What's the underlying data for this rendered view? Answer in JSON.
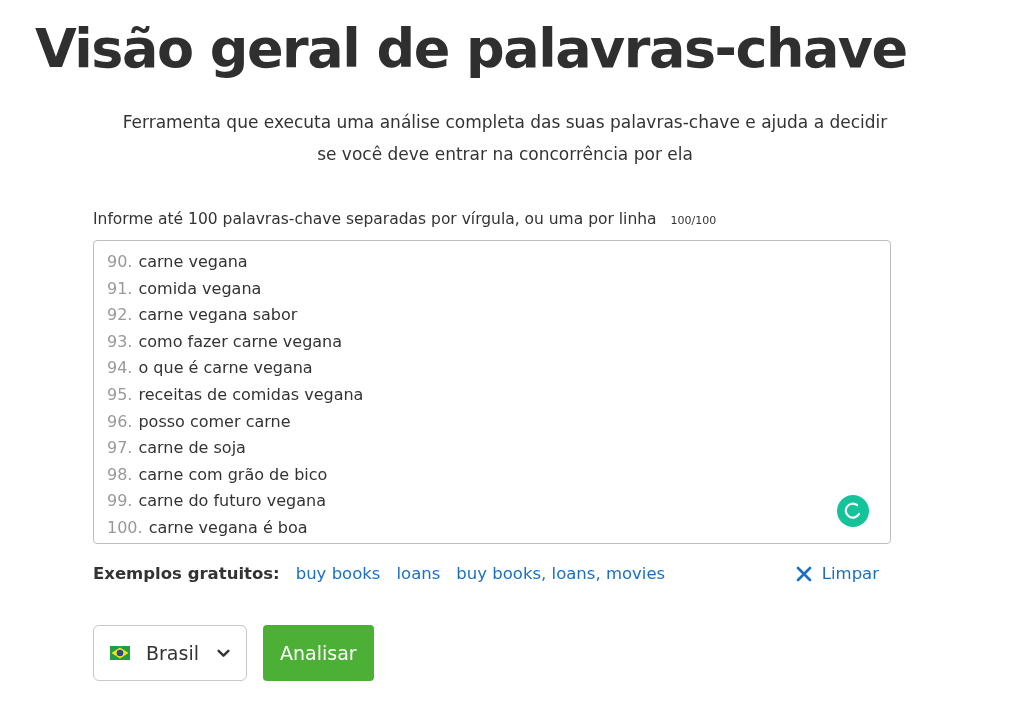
{
  "title": "Visão geral de palavras-chave",
  "subtitle": "Ferramenta que executa uma análise completa das suas palavras-chave e ajuda a decidir se você deve entrar na concorrência por ela",
  "input_label": "Informe até 100 palavras-chave separadas por vírgula, ou uma por linha",
  "counter": "100/100",
  "keywords": [
    {
      "number": "90.",
      "text": "carne vegana"
    },
    {
      "number": "91.",
      "text": "comida vegana"
    },
    {
      "number": "92.",
      "text": "carne vegana sabor"
    },
    {
      "number": "93.",
      "text": "como fazer carne vegana"
    },
    {
      "number": "94.",
      "text": "o que é carne vegana"
    },
    {
      "number": "95.",
      "text": "receitas de comidas vegana"
    },
    {
      "number": "96.",
      "text": "posso comer carne"
    },
    {
      "number": "97.",
      "text": "carne de soja"
    },
    {
      "number": "98.",
      "text": "carne com grão de bico"
    },
    {
      "number": "99.",
      "text": "carne do futuro vegana"
    },
    {
      "number": "100.",
      "text": "carne vegana é boa"
    }
  ],
  "examples_label": "Exemplos gratuitos:",
  "examples": [
    "buy books",
    "loans",
    "buy books, loans, movies"
  ],
  "clear_button": "Limpar",
  "country": "Brasil",
  "analyze_button": "Analisar"
}
